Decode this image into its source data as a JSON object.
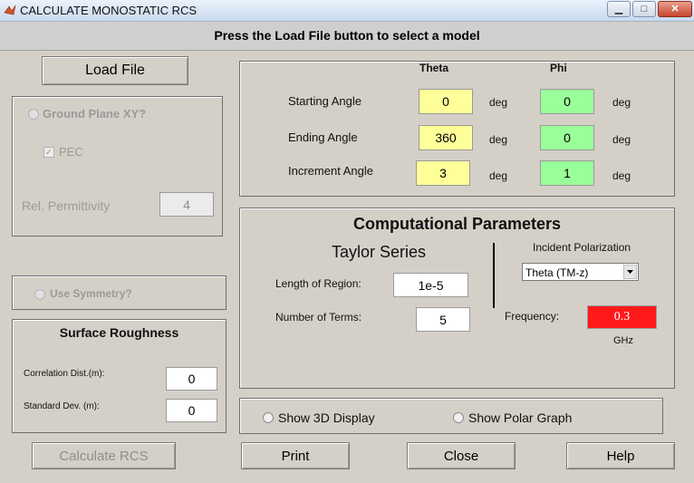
{
  "window": {
    "title": "CALCULATE MONOSTATIC RCS",
    "minimize": "▁",
    "maximize": "□",
    "close": "✕"
  },
  "header": {
    "text": "Press the Load File button to select a model"
  },
  "load_file": "Load File",
  "ground": {
    "label": "Ground Plane XY?",
    "pec_label": "PEC",
    "pec_check": "✓",
    "permittivity_label": "Rel. Permittivity",
    "permittivity_value": "4"
  },
  "angles": {
    "theta_header": "Theta",
    "phi_header": "Phi",
    "unit": "deg",
    "rows": [
      {
        "label": "Starting Angle",
        "theta": "0",
        "phi": "0"
      },
      {
        "label": "Ending Angle",
        "theta": "360",
        "phi": "0"
      },
      {
        "label": "Increment Angle",
        "theta": "3",
        "phi": "1"
      }
    ]
  },
  "comp": {
    "title": "Computational Parameters",
    "taylor_title": "Taylor Series",
    "length_label": "Length of Region:",
    "length_value": "1e-5",
    "terms_label": "Number of Terms:",
    "terms_value": "5",
    "polarization_label": "Incident Polarization",
    "polarization_value": "Theta (TM-z)",
    "frequency_label": "Frequency:",
    "frequency_value": "0.3",
    "frequency_unit": "GHz"
  },
  "symmetry": {
    "label": "Use Symmetry?"
  },
  "roughness": {
    "title": "Surface Roughness",
    "corr_label": "Correlation Dist.(m):",
    "corr_value": "0",
    "std_label": "Standard Dev. (m):",
    "std_value": "0"
  },
  "display": {
    "show3d": "Show 3D Display",
    "polar": "Show Polar Graph"
  },
  "buttons": {
    "calculate": "Calculate RCS",
    "print": "Print",
    "close": "Close",
    "help": "Help"
  },
  "colors": {
    "theta_field": "#ffff99",
    "phi_field": "#99ff99",
    "frequency_field": "#ff1a1a"
  }
}
